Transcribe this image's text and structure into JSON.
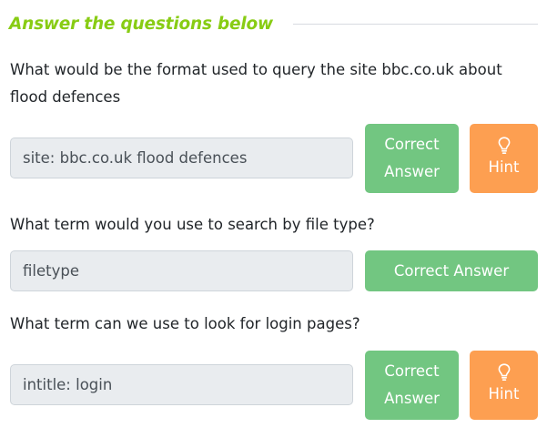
{
  "section": {
    "title": "Answer the questions below"
  },
  "questions": [
    {
      "text": "What would be the format used to query the site bbc.co.uk about flood defences",
      "answer": "site: bbc.co.uk flood defences",
      "correct_line1": "Correct",
      "correct_line2": "Answer",
      "hint_label": "Hint",
      "hint_icon": "lightbulb-icon"
    },
    {
      "text": "What term would you use to search by file type?",
      "answer": "filetype",
      "correct_label": "Correct Answer"
    },
    {
      "text": "What term can we use to look for login pages?",
      "answer": "intitle: login",
      "correct_line1": "Correct",
      "correct_line2": "Answer",
      "hint_label": "Hint",
      "hint_icon": "lightbulb-icon"
    }
  ],
  "colors": {
    "title_green": "#88cc14",
    "correct_button": "#72c681",
    "hint_button": "#fd9f51",
    "input_bg": "#e9ecef"
  }
}
